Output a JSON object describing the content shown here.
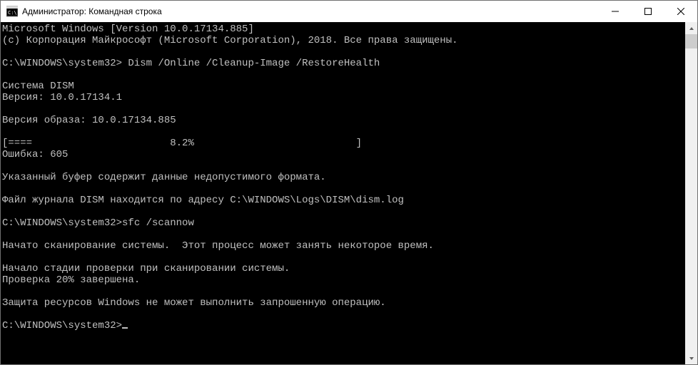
{
  "titlebar": {
    "title": "Администратор: Командная строка"
  },
  "console": {
    "lines": [
      "Microsoft Windows [Version 10.0.17134.885]",
      "(c) Корпорация Майкрософт (Microsoft Corporation), 2018. Все права защищены.",
      "",
      "C:\\WINDOWS\\system32> Dism /Online /Cleanup-Image /RestoreHealth",
      "",
      "Cистема DISM",
      "Версия: 10.0.17134.1",
      "",
      "Версия образа: 10.0.17134.885",
      "",
      "[====                       8.2%                           ]",
      "Ошибка: 605",
      "",
      "Указанный буфер содержит данные недопустимого формата.",
      "",
      "Файл журнала DISM находится по адресу C:\\WINDOWS\\Logs\\DISM\\dism.log",
      "",
      "C:\\WINDOWS\\system32>sfc /scannow",
      "",
      "Начато сканирование системы.  Этот процесс может занять некоторое время.",
      "",
      "Начало стадии проверки при сканировании системы.",
      "Проверка 20% завершена.",
      "",
      "Защита ресурсов Windows не может выполнить запрошенную операцию.",
      "",
      "C:\\WINDOWS\\system32>"
    ]
  }
}
